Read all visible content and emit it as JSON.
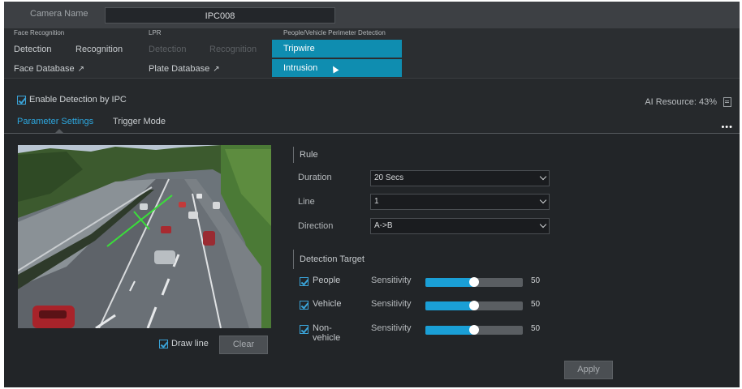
{
  "camera": {
    "label": "Camera Name",
    "value": "IPC008"
  },
  "menu": {
    "face": {
      "header": "Face Recognition",
      "detection": "Detection",
      "recognition": "Recognition",
      "database": "Face Database",
      "ext": "↗"
    },
    "lpr": {
      "header": "LPR",
      "detection": "Detection",
      "recognition": "Recognition",
      "database": "Plate Database",
      "ext": "↗"
    },
    "perimeter": {
      "header": "People/Vehicle Perimeter Detection",
      "tripwire": "Tripwire",
      "intrusion": "Intrusion"
    }
  },
  "enable": {
    "label": "Enable Detection by IPC",
    "checked": true
  },
  "ai_resource": "AI Resource: 43%",
  "tabs": [
    "Parameter Settings",
    "Trigger Mode"
  ],
  "more": "•••",
  "video": {
    "draw_line_label": "Draw line",
    "clear_label": "Clear"
  },
  "rule": {
    "title": "Rule",
    "duration_label": "Duration",
    "duration_value": "20 Secs",
    "line_label": "Line",
    "line_value": "1",
    "direction_label": "Direction",
    "direction_value": "A->B"
  },
  "targets": {
    "title": "Detection Target",
    "sensitivity_label": "Sensitivity",
    "items": [
      {
        "name": "People",
        "checked": true,
        "value": "50",
        "fraction": 0.5
      },
      {
        "name": "Vehicle",
        "checked": true,
        "value": "50",
        "fraction": 0.5
      },
      {
        "name": "Non-vehicle",
        "checked": true,
        "value": "50",
        "fraction": 0.5
      }
    ]
  },
  "apply_label": "Apply",
  "colors": {
    "accent": "#1a9fd6",
    "highlight": "#0f8db0",
    "background": "#26292c"
  }
}
